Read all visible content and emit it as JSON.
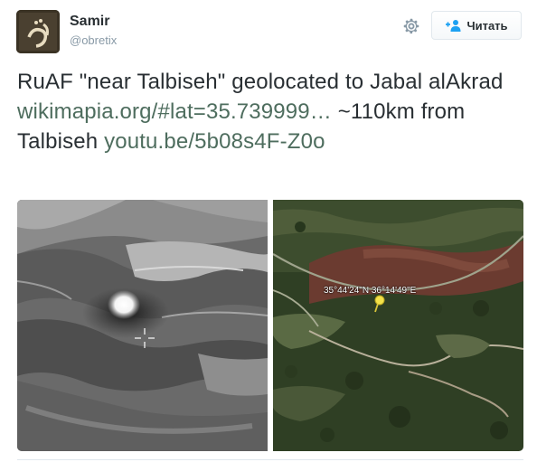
{
  "author": {
    "name": "Samir",
    "handle": "@obretix"
  },
  "follow_button": {
    "label": "Читать"
  },
  "tweet": {
    "text_before_link1": "RuAF \"near Talbiseh\" geolocated to Jabal alAkrad ",
    "link1": "wikimapia.org/#lat=35.739999…",
    "text_before_link2": " ~110km from Talbiseh ",
    "link2": "youtu.be/5b08s4F-Z0o"
  },
  "photo_right": {
    "coordinate_label": "35°44'24\"N  36°14'49\"E"
  },
  "colors": {
    "link": "#4e6d5e",
    "text": "#292f33",
    "follow_icon": "#1da1f2"
  },
  "icons": {
    "settings": "gear-icon",
    "follow": "add-user-icon",
    "pin": "map-pin-icon"
  }
}
